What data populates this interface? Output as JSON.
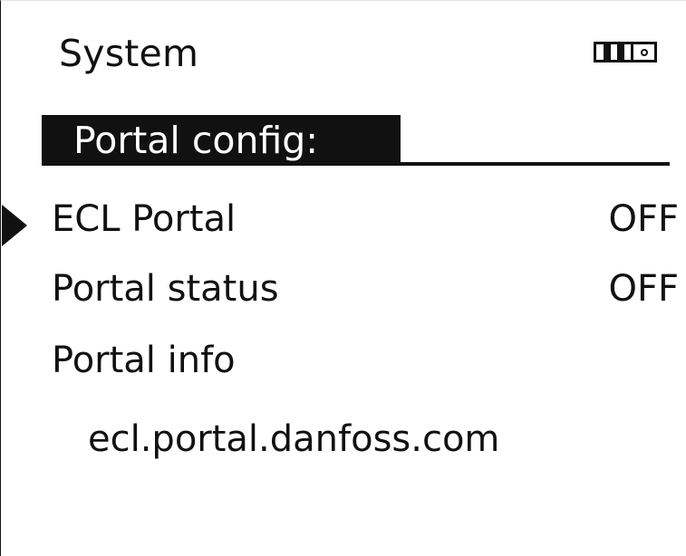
{
  "header": {
    "title": "System",
    "mode_icon": "display-mode-icon"
  },
  "submenu": {
    "title": "Portal config:"
  },
  "items": [
    {
      "label": "ECL Portal",
      "value": "OFF",
      "selected": true
    },
    {
      "label": "Portal status",
      "value": "OFF",
      "selected": false
    },
    {
      "label": "Portal info",
      "value": "",
      "selected": false
    }
  ],
  "portal_info": {
    "url": "ecl.portal.danfoss.com"
  },
  "colors": {
    "foreground": "#111111",
    "background": "#ffffff"
  }
}
